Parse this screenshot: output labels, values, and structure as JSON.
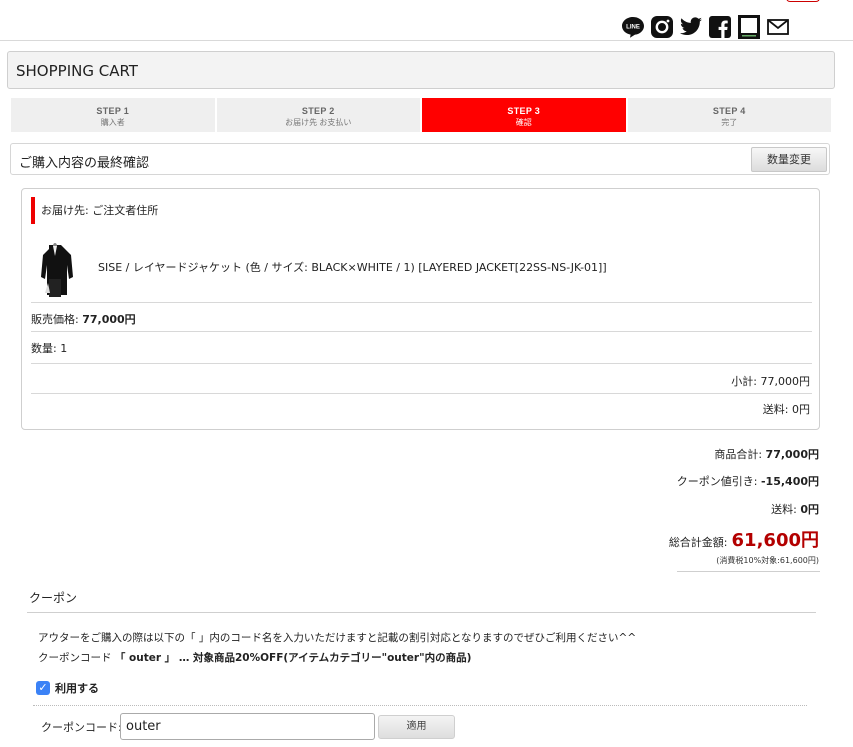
{
  "header": {
    "social_icons": [
      "line-icon",
      "instagram-icon",
      "twitter-icon",
      "facebook-icon",
      "blog-icon",
      "mail-icon"
    ]
  },
  "cart": {
    "title": "SHOPPING CART"
  },
  "steps": [
    {
      "num": "STEP 1",
      "label": "購入者",
      "active": false
    },
    {
      "num": "STEP 2",
      "label": "お届け先 お支払い",
      "active": false
    },
    {
      "num": "STEP 3",
      "label": "確認",
      "active": true
    },
    {
      "num": "STEP 4",
      "label": "完了",
      "active": false
    }
  ],
  "confirm": {
    "title": "ご購入内容の最終確認",
    "qty_button": "数量変更"
  },
  "order": {
    "delivery": "お届け先: ご注文者住所",
    "product_name": "SISE / レイヤードジャケット (色 / サイズ: BLACK×WHITE / 1) [LAYERED JACKET[22SS-NS-JK-01]]",
    "price_label": "販売価格: ",
    "price": "77,000円",
    "qty": "数量: 1",
    "subtotal": "小計: 77,000円",
    "shipping": "送料: 0円"
  },
  "totals": {
    "items_label": "商品合計: ",
    "items": "77,000円",
    "coupon_label": "クーポン値引き: ",
    "coupon": "-15,400円",
    "shipping_label": "送料: ",
    "shipping": "0円",
    "grand_label": "総合計金額:",
    "grand": "61,600円",
    "tax": "(消費税10%対象:61,600円)"
  },
  "coupon": {
    "title": "クーポン",
    "line1": "アウターをご購入の際は以下の「 」内のコード名を入力いただけますと記載の割引対応となりますのでぜひご利用ください^^",
    "line2_prefix": "クーポンコード ",
    "line2_bold": "「 outer 」 … 対象商品20%OFF(アイテムカテゴリー\"outer\"内の商品)",
    "use_label": "利用する",
    "code_label": "クーポンコード:",
    "code_value": "outer",
    "apply": "適用"
  },
  "colors": {
    "accent": "#ff0000",
    "price_red": "#b30000",
    "checkbox": "#3b82f6"
  }
}
